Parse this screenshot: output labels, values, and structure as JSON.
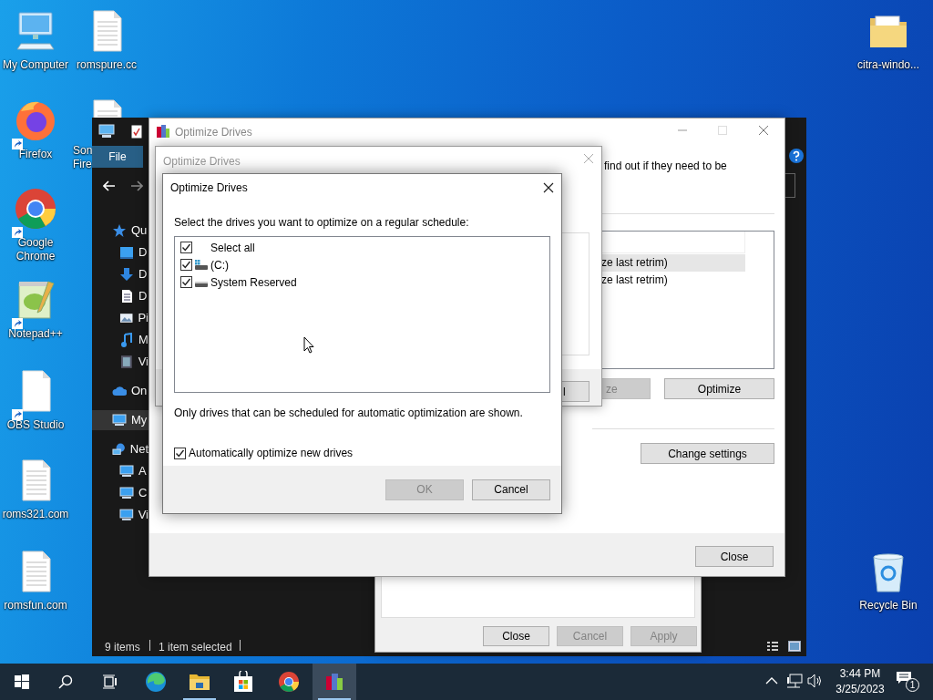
{
  "desktop_icons": [
    {
      "label": "My Computer",
      "kind": "computer",
      "shortcut": false
    },
    {
      "label": "romspure.cc",
      "kind": "document",
      "shortcut": false
    },
    {
      "label": "Firefox",
      "kind": "firefox",
      "shortcut": true
    },
    {
      "label": "Son Fire",
      "kind": "document"
    },
    {
      "label": "Google Chrome",
      "kind": "chrome",
      "shortcut": true
    },
    {
      "label": "Notepad++",
      "kind": "notepad",
      "shortcut": true
    },
    {
      "label": "OBS Studio",
      "kind": "blank",
      "shortcut": true
    },
    {
      "label": "roms321.com",
      "kind": "document",
      "shortcut": false
    },
    {
      "label": "romsfun.com",
      "kind": "document",
      "shortcut": false
    },
    {
      "label": "citra-windo...",
      "kind": "folder",
      "shortcut": false
    },
    {
      "label": "Recycle Bin",
      "kind": "recycle",
      "shortcut": false
    }
  ],
  "explorer": {
    "menu_tab": "File",
    "nav_items": [
      {
        "label": "Qu",
        "kind": "star",
        "selected": false
      },
      {
        "label": "D",
        "kind": "desktop",
        "selected": false
      },
      {
        "label": "D",
        "kind": "download",
        "selected": false
      },
      {
        "label": "D",
        "kind": "document",
        "selected": false
      },
      {
        "label": "Pi",
        "kind": "pictures",
        "selected": false
      },
      {
        "label": "M",
        "kind": "music",
        "selected": false
      },
      {
        "label": "Vi",
        "kind": "videos",
        "selected": false
      },
      {
        "label": "On",
        "kind": "cloud",
        "selected": false
      },
      {
        "label": "My",
        "kind": "computer",
        "selected": true
      },
      {
        "label": "Net",
        "kind": "network",
        "selected": false
      },
      {
        "label": "A",
        "kind": "computer",
        "selected": false
      },
      {
        "label": "C",
        "kind": "computer",
        "selected": false
      },
      {
        "label": "Vi",
        "kind": "computer",
        "selected": false
      }
    ],
    "status": [
      "9 items",
      "1 item selected"
    ]
  },
  "properties_dialog": {
    "buttons": [
      {
        "label": "Close",
        "disabled": false
      },
      {
        "label": "Cancel",
        "disabled": true
      },
      {
        "label": "Apply",
        "disabled": true
      }
    ]
  },
  "optimize_window": {
    "title": "Optimize Drives",
    "description": "find out if they need to be",
    "drive_rows": [
      {
        "text": "ze last retrim)",
        "selected": true
      },
      {
        "text": "ze last retrim)",
        "selected": false
      }
    ],
    "buttons": [
      {
        "label": "ze",
        "disabled": true
      },
      {
        "label": "Optimize",
        "disabled": false
      }
    ],
    "change_button": "Change settings",
    "close_button": "Close"
  },
  "schedule_dialog": {
    "title": "Optimize Drives",
    "button_fragment": "l"
  },
  "drives_dialog": {
    "title": "Optimize Drives",
    "prompt": "Select the drives you want to optimize on a regular schedule:",
    "drives": [
      {
        "label": "Select all",
        "kind": "all",
        "checked": true
      },
      {
        "label": "(C:)",
        "kind": "system",
        "checked": true
      },
      {
        "label": "System Reserved",
        "kind": "drive",
        "checked": true
      }
    ],
    "note": "Only drives that can be scheduled for automatic optimization are shown.",
    "auto_optimize": {
      "label": "Automatically optimize new drives",
      "checked": true
    },
    "buttons": [
      {
        "label": "OK",
        "disabled": true
      },
      {
        "label": "Cancel",
        "disabled": false
      }
    ]
  },
  "taskbar": {
    "apps": [
      {
        "kind": "edge",
        "running": false,
        "active": false
      },
      {
        "kind": "explorer",
        "running": true,
        "active": false
      },
      {
        "kind": "store",
        "running": false,
        "active": false
      },
      {
        "kind": "chrome",
        "running": false,
        "active": false
      },
      {
        "kind": "defrag",
        "running": true,
        "active": true
      }
    ],
    "time": "3:44 PM",
    "date": "3/25/2023",
    "notification_count": "1"
  }
}
